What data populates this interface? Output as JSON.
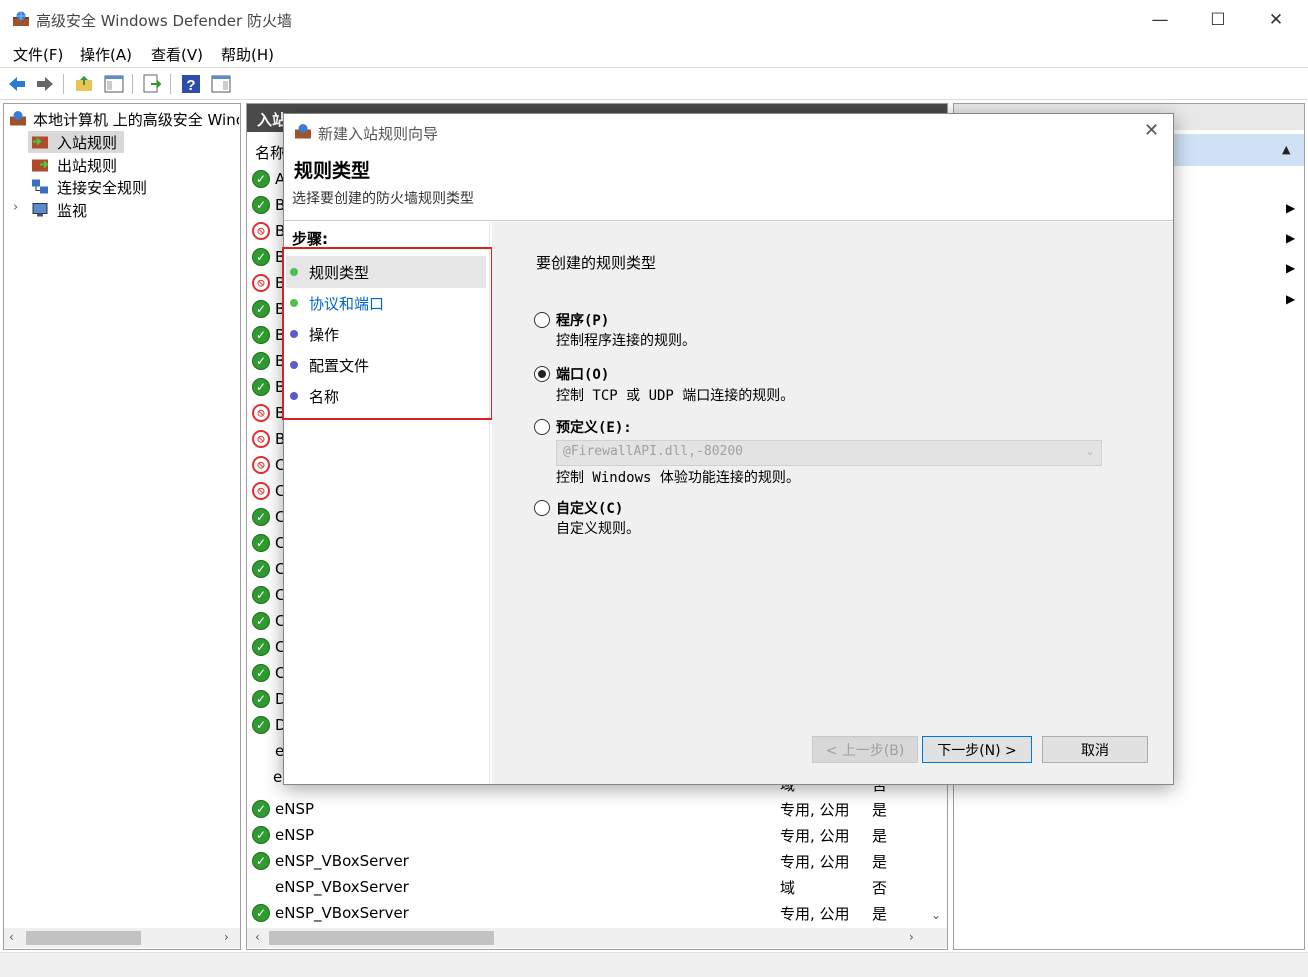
{
  "window": {
    "title": "高级安全 Windows Defender 防火墙",
    "minimize": "—",
    "maximize": "☐",
    "close": "✕"
  },
  "menu": [
    "文件(F)",
    "操作(A)",
    "查看(V)",
    "帮助(H)"
  ],
  "tree": {
    "root": "本地计算机 上的高级安全 Winc",
    "items": [
      "入站规则",
      "出站规则",
      "连接安全规则",
      "监视"
    ],
    "expander": "›"
  },
  "middle": {
    "tab_label": "入站",
    "header_name": "名称",
    "partial_rows": [
      {
        "status": "ok",
        "letter": "A"
      },
      {
        "status": "ok",
        "letter": "B"
      },
      {
        "status": "block",
        "letter": "B"
      },
      {
        "status": "ok",
        "letter": "B"
      },
      {
        "status": "block",
        "letter": "B"
      },
      {
        "status": "ok",
        "letter": "B"
      },
      {
        "status": "ok",
        "letter": "B"
      },
      {
        "status": "ok",
        "letter": "B"
      },
      {
        "status": "ok",
        "letter": "B"
      },
      {
        "status": "block",
        "letter": "B"
      },
      {
        "status": "block",
        "letter": "B"
      },
      {
        "status": "block",
        "letter": "C"
      },
      {
        "status": "block",
        "letter": "C"
      },
      {
        "status": "ok",
        "letter": "C"
      },
      {
        "status": "ok",
        "letter": "C"
      },
      {
        "status": "ok",
        "letter": "C"
      },
      {
        "status": "ok",
        "letter": "C"
      },
      {
        "status": "ok",
        "letter": "C"
      },
      {
        "status": "ok",
        "letter": "C"
      },
      {
        "status": "ok",
        "letter": "C"
      },
      {
        "status": "ok",
        "letter": "D"
      },
      {
        "status": "ok",
        "letter": "D"
      },
      {
        "status": "none",
        "letter": "e"
      },
      {
        "status": "none",
        "letter": "eNSP"
      }
    ],
    "partial_row_tail": {
      "profile": "域",
      "enabled": "否"
    },
    "rows": [
      {
        "status": "ok",
        "name": "eNSP",
        "profile": "专用, 公用",
        "enabled": "是"
      },
      {
        "status": "ok",
        "name": "eNSP",
        "profile": "专用, 公用",
        "enabled": "是"
      },
      {
        "status": "ok",
        "name": "eNSP_VBoxServer",
        "profile": "专用, 公用",
        "enabled": "是"
      },
      {
        "status": "none",
        "name": "eNSP_VBoxServer",
        "profile": "域",
        "enabled": "否"
      },
      {
        "status": "ok",
        "name": "eNSP_VBoxServer",
        "profile": "专用, 公用",
        "enabled": "是"
      }
    ]
  },
  "dialog": {
    "title": "新建入站规则向导",
    "heading": "规则类型",
    "subheading": "选择要创建的防火墙规则类型",
    "steps_label": "步骤:",
    "steps": [
      {
        "label": "规则类型",
        "state": "current"
      },
      {
        "label": "协议和端口",
        "state": "link"
      },
      {
        "label": "操作",
        "state": "pending"
      },
      {
        "label": "配置文件",
        "state": "pending"
      },
      {
        "label": "名称",
        "state": "pending"
      }
    ],
    "prompt": "要创建的规则类型",
    "options": [
      {
        "label": "程序(P)",
        "desc": "控制程序连接的规则。",
        "selected": false
      },
      {
        "label": "端口(O)",
        "desc": "控制 TCP 或 UDP 端口连接的规则。",
        "selected": true
      },
      {
        "label": "预定义(E):",
        "desc": "控制 Windows 体验功能连接的规则。",
        "selected": false,
        "dropdown": "@FirewallAPI.dll,-80200"
      },
      {
        "label": "自定义(C)",
        "desc": "自定义规则。",
        "selected": false
      }
    ],
    "buttons": {
      "back": "< 上一步(B)",
      "next": "下一步(N) >",
      "cancel": "取消"
    }
  },
  "colors": {
    "accent": "#0066cc",
    "highlight_box": "#e02020",
    "ok_green": "#2f9b30",
    "block_red": "#e03030"
  }
}
